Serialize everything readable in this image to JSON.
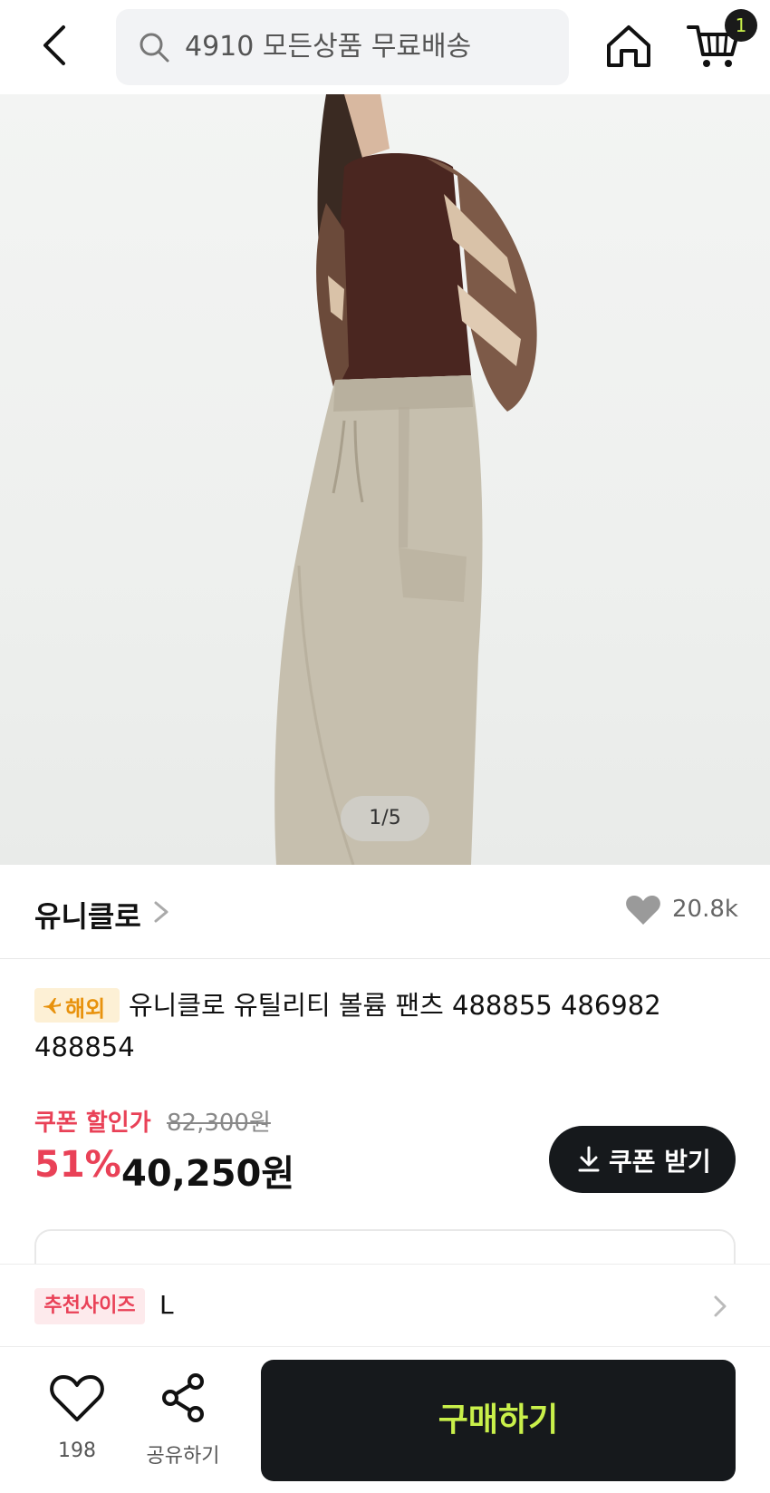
{
  "header": {
    "search_placeholder": "4910 모든상품 무료배송",
    "cart_count": "1"
  },
  "hero": {
    "page_indicator": "1/5"
  },
  "brand": {
    "name": "유니클로",
    "like_count": "20.8k"
  },
  "product": {
    "badge": "해외",
    "title": "유니클로 유틸리티 볼륨 팬츠 488855 486982 488854"
  },
  "price": {
    "coupon_label": "쿠폰 할인가",
    "original_price": "82,300원",
    "discount_rate": "51%",
    "sale_price": "40,250원",
    "coupon_button": "쿠폰 받기"
  },
  "size": {
    "tag": "추천사이즈",
    "value": "L"
  },
  "bottom_bar": {
    "wish_count": "198",
    "share_label": "공유하기",
    "buy_label": "구매하기"
  },
  "colors": {
    "accent_red": "#e94157",
    "buy_text": "#c9f04a",
    "dark": "#16191c"
  }
}
